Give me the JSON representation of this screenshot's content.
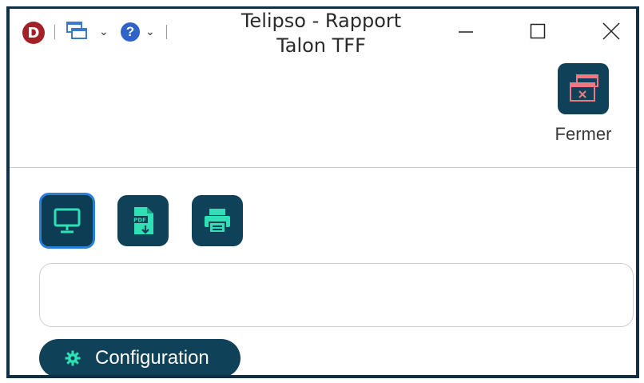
{
  "window": {
    "title_line1": "Telipso - Rapport",
    "title_line2": "Talon TFF"
  },
  "titlebar": {
    "logo_letter": "D",
    "help_glyph": "?",
    "chevron": "⌄"
  },
  "toolbar": {
    "close_label": "Fermer"
  },
  "output_buttons": [
    {
      "name": "screen",
      "icon": "monitor-icon",
      "active": true
    },
    {
      "name": "pdf",
      "icon": "pdf-icon",
      "active": false
    },
    {
      "name": "print",
      "icon": "printer-icon",
      "active": false
    }
  ],
  "field": {
    "value": ""
  },
  "config": {
    "label": "Configuration"
  },
  "colors": {
    "accent_dark": "#0f4158",
    "icon_teal": "#2ee0b4",
    "close_icon": "#f07882",
    "active_border": "#2b7fd9"
  }
}
